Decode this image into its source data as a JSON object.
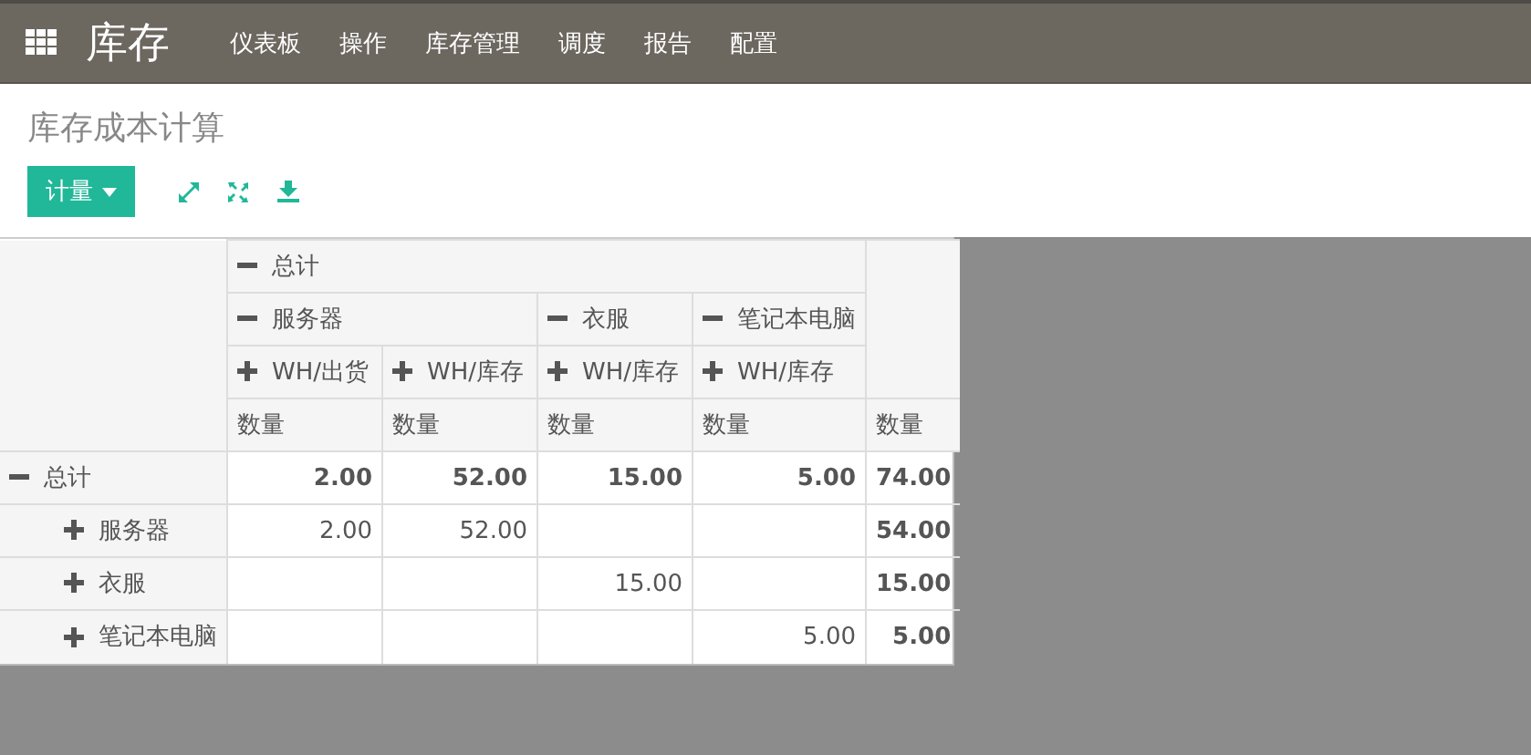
{
  "app": {
    "title": "库存",
    "menu": [
      "仪表板",
      "操作",
      "库存管理",
      "调度",
      "报告",
      "配置"
    ]
  },
  "page": {
    "title": "库存成本计算",
    "measure_button": "计量"
  },
  "pivot": {
    "columns": {
      "label": "总计",
      "expanded": true,
      "children": [
        {
          "label": "服务器",
          "expanded": true,
          "children": [
            {
              "label": "WH/出货",
              "expanded": false
            },
            {
              "label": "WH/库存",
              "expanded": false
            }
          ]
        },
        {
          "label": "衣服",
          "expanded": true,
          "children": [
            {
              "label": "WH/库存",
              "expanded": false
            }
          ]
        },
        {
          "label": "笔记本电脑",
          "expanded": true,
          "children": [
            {
              "label": "WH/库存",
              "expanded": false
            }
          ]
        }
      ]
    },
    "measures": [
      "数量",
      "数量",
      "数量",
      "数量",
      "数量"
    ],
    "rows": [
      {
        "label": "总计",
        "expanded": true,
        "cells": [
          "2.00",
          "52.00",
          "15.00",
          "5.00"
        ],
        "total": "74.00",
        "children": [
          {
            "label": "服务器",
            "expanded": false,
            "cells": [
              "2.00",
              "52.00",
              null,
              null
            ],
            "total": "54.00"
          },
          {
            "label": "衣服",
            "expanded": false,
            "cells": [
              null,
              null,
              "15.00",
              null
            ],
            "total": "15.00"
          },
          {
            "label": "笔记本电脑",
            "expanded": false,
            "cells": [
              null,
              null,
              null,
              "5.00"
            ],
            "total": "5.00"
          }
        ]
      }
    ]
  }
}
